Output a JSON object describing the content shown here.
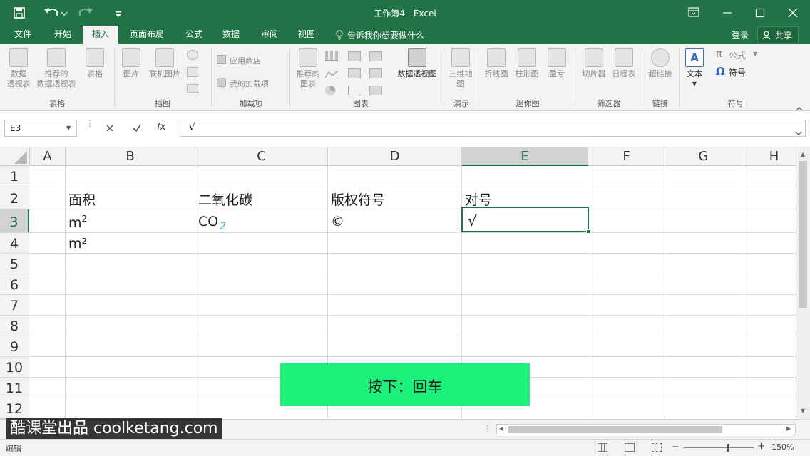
{
  "window": {
    "title": "工作簿4 - Excel"
  },
  "tabs": [
    {
      "label": "文件"
    },
    {
      "label": "开始"
    },
    {
      "label": "插入"
    },
    {
      "label": "页面布局"
    },
    {
      "label": "公式"
    },
    {
      "label": "数据"
    },
    {
      "label": "审阅"
    },
    {
      "label": "视图"
    }
  ],
  "tell_me": "告诉我你想要做什么",
  "login": "登录",
  "share": "共享",
  "ribbon": {
    "tables": {
      "b1": "数据\n透视表",
      "b2": "推荐的\n数据透视表",
      "b3": "表格",
      "group": "表格"
    },
    "illus": {
      "b1": "图片",
      "b2": "联机图片",
      "group": "插图"
    },
    "addins": {
      "b1": "应用商店",
      "b2": "我的加载项",
      "group": "加载项"
    },
    "charts": {
      "b1": "推荐的\n图表",
      "b2": "数据透视图",
      "group": "图表"
    },
    "tours": {
      "b1": "三维地\n图",
      "group": "演示"
    },
    "spark": {
      "b1": "折线图",
      "b2": "柱形图",
      "b3": "盈亏",
      "group": "迷你图"
    },
    "filters": {
      "b1": "切片器",
      "b2": "日程表",
      "group": "筛选器"
    },
    "links": {
      "b1": "超链接",
      "group": "链接"
    },
    "text": {
      "b1": "文本"
    },
    "symbols": {
      "b1": "公式",
      "b2": "符号",
      "group": "符号"
    }
  },
  "namebox": "E3",
  "formula": "√",
  "fx": "fx",
  "columns": [
    "A",
    "B",
    "C",
    "D",
    "E",
    "F",
    "G",
    "H"
  ],
  "rows": [
    "1",
    "2",
    "3",
    "4",
    "5",
    "6",
    "7",
    "8",
    "9",
    "10",
    "11",
    "12"
  ],
  "cells": {
    "b2": "面积",
    "c2": "二氧化碳",
    "d2": "版权符号",
    "e2": "对号",
    "b3": "m",
    "b3_sup": "2",
    "c3": "CO",
    "c3_sub": "2",
    "d3": "©",
    "e3": "√",
    "b4": "m²"
  },
  "overlay": {
    "key_hint": "按下：回车",
    "watermark": "酷课堂出品 coolketang.com"
  },
  "status": {
    "mode": "编辑",
    "zoom": "150%"
  },
  "colors": {
    "brand": "#217346",
    "hint": "#1af07a",
    "subscript": "#2ab0c8"
  }
}
